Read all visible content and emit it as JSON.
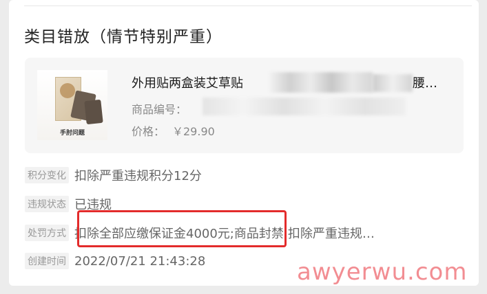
{
  "section": {
    "title": "类目错放（情节特别严重）"
  },
  "product": {
    "thumbnail_caption": "手肘问题",
    "name_start": "外用贴两盒装艾草贴",
    "name_end": "腰…",
    "code_label": "商品编号：",
    "price_label": "价格：",
    "price_value": "￥29.90"
  },
  "details": [
    {
      "label": "积分变化",
      "value": "扣除严重违规积分12分"
    },
    {
      "label": "违规状态",
      "value": "已违规"
    },
    {
      "label": "处罚方式",
      "value": "扣除全部应缴保证金4000元;商品封禁;扣除严重违规…"
    },
    {
      "label": "创建时间",
      "value": "2022/07/21 21:43:28"
    }
  ],
  "watermark": "awyerwu.com",
  "colors": {
    "highlight_border": "#e32b2b",
    "watermark": "#f07a80"
  }
}
